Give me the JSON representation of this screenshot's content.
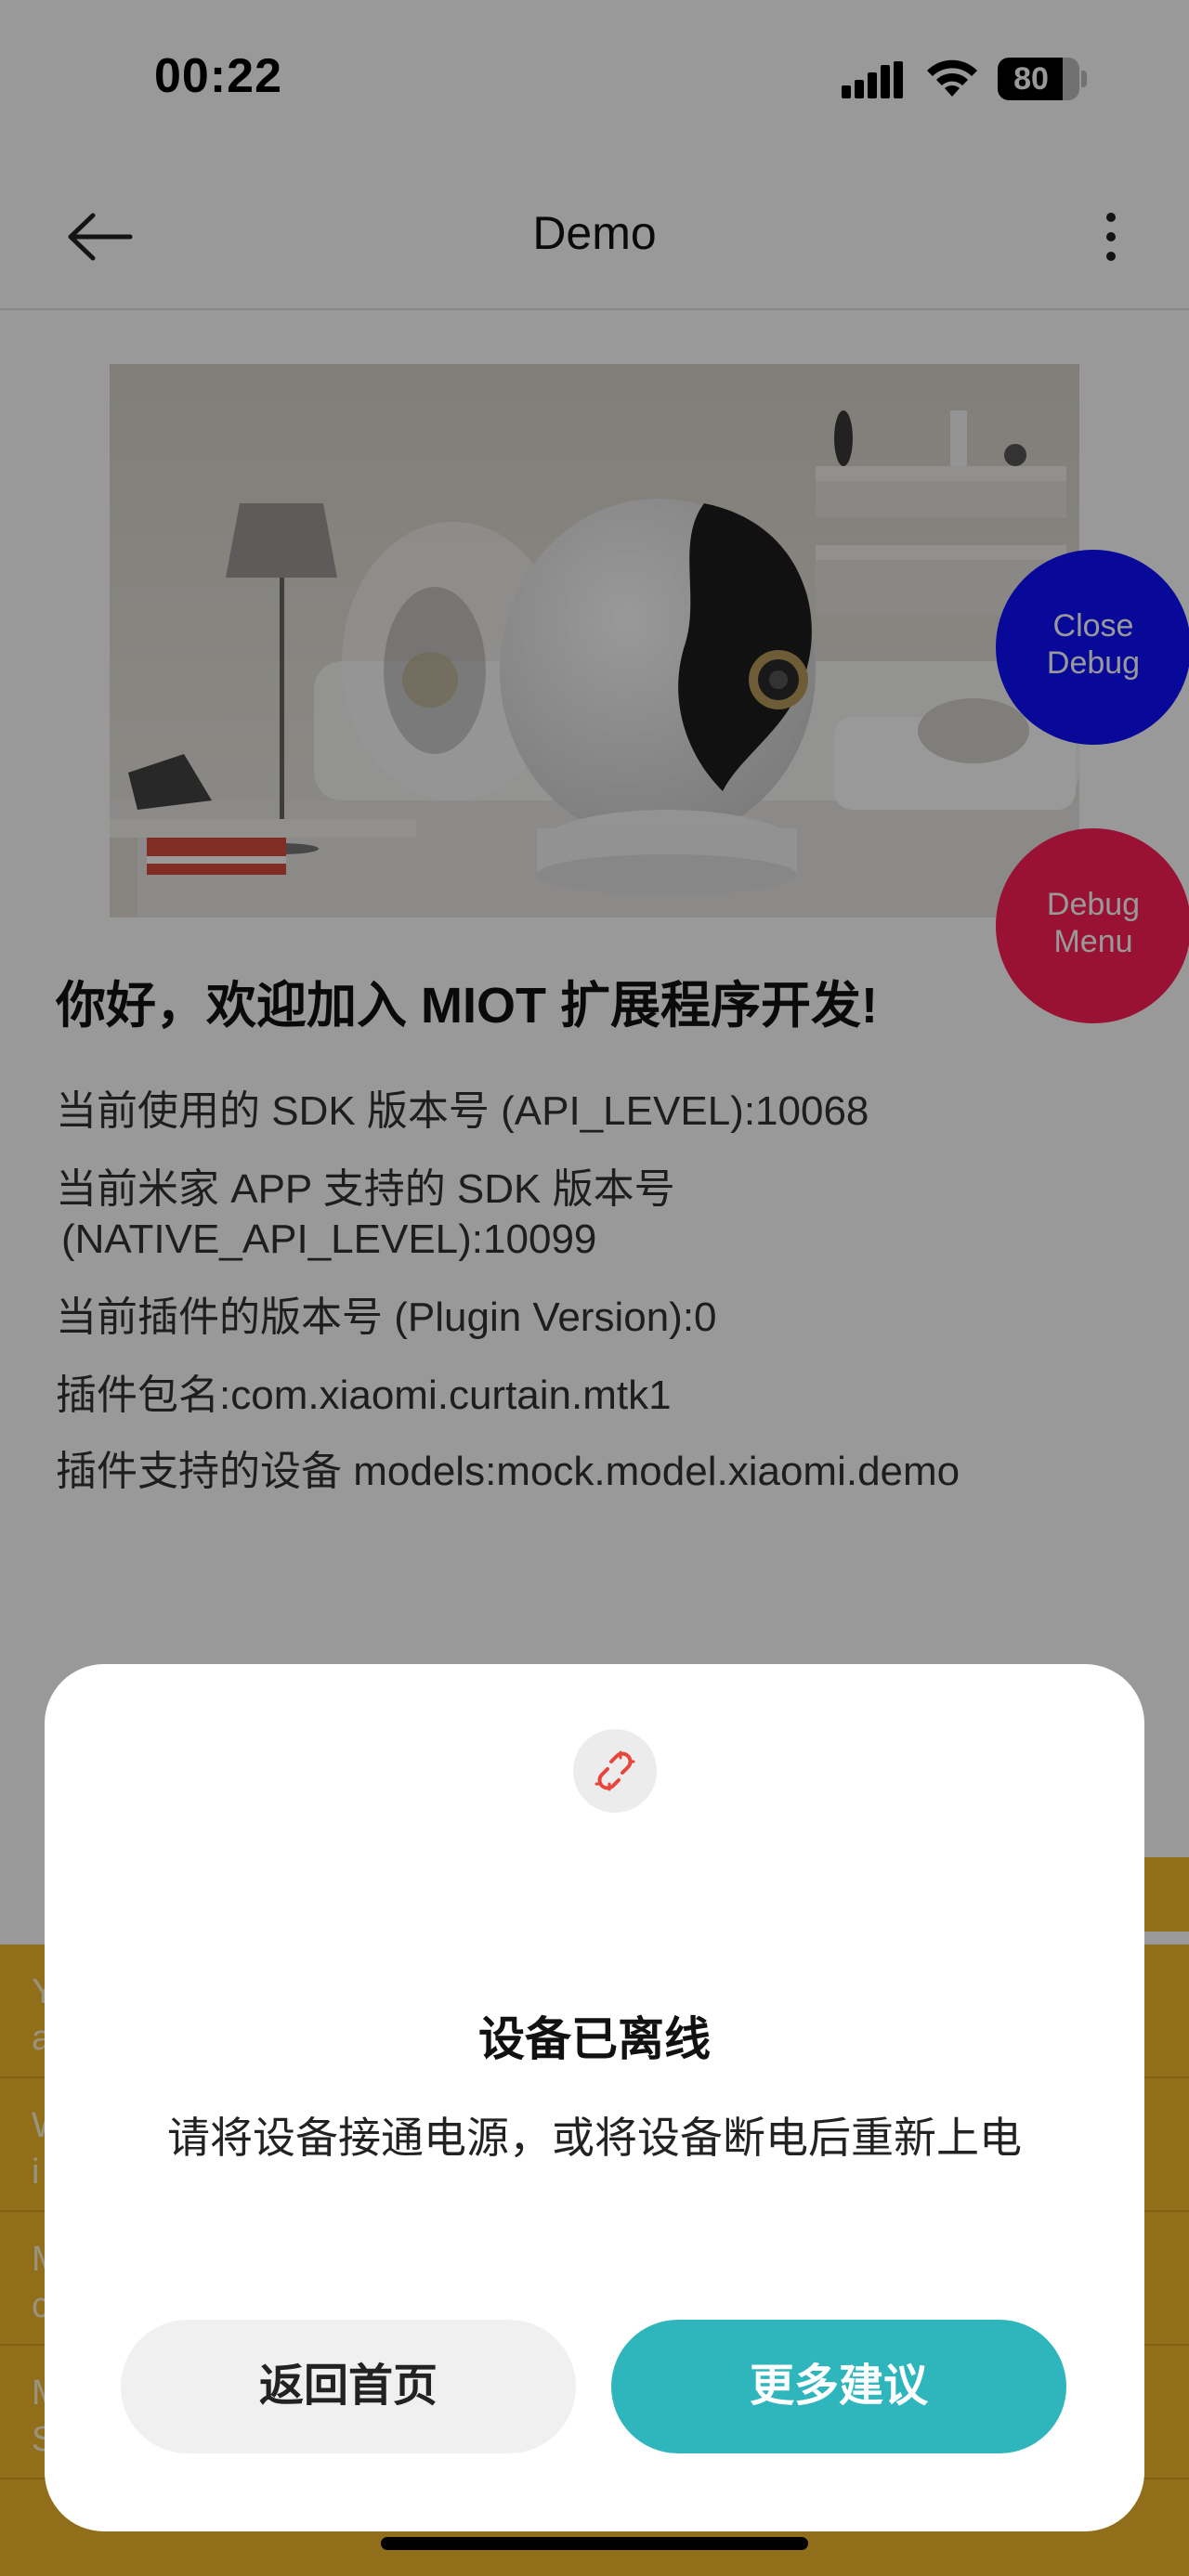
{
  "status_bar": {
    "time": "00:22",
    "battery": "80",
    "battery_level": 0.8
  },
  "nav": {
    "title": "Demo",
    "back_icon": "arrow-left-icon",
    "more_icon": "more-vertical-icon"
  },
  "welcome": {
    "title": "你好，欢迎加入 MIOT 扩展程序开发!",
    "lines": [
      "当前使用的 SDK 版本号 (API_LEVEL):10068",
      "当前米家 APP 支持的 SDK 版本号",
      "(NATIVE_API_LEVEL):10099",
      "当前插件的版本号 (Plugin Version):0",
      "插件包名:com.xiaomi.curtain.mtk1",
      "插件支持的设备 models:mock.model.xiaomi.demo"
    ]
  },
  "debug": {
    "close_line1": "Close",
    "close_line2": "Debug",
    "menu_line1": "Debug",
    "menu_line2": "Menu"
  },
  "background_rows": [
    {
      "line1": "Y",
      "line2": "a"
    },
    {
      "line1": "W",
      "line2": "i"
    },
    {
      "line1": "M",
      "line2": "c"
    },
    {
      "line1": "M",
      "line2": "S"
    }
  ],
  "dialog": {
    "icon": "link-broken-icon",
    "title": "设备已离线",
    "message": "请将设备接通电源，或将设备断电后重新上电",
    "cancel_label": "返回首页",
    "confirm_label": "更多建议"
  },
  "colors": {
    "accent": "#2fb6bd",
    "debug_close": "#1010ff",
    "debug_menu": "#ff1f58",
    "yellow": "#f2b82c",
    "offline_icon": "#e8453c"
  }
}
